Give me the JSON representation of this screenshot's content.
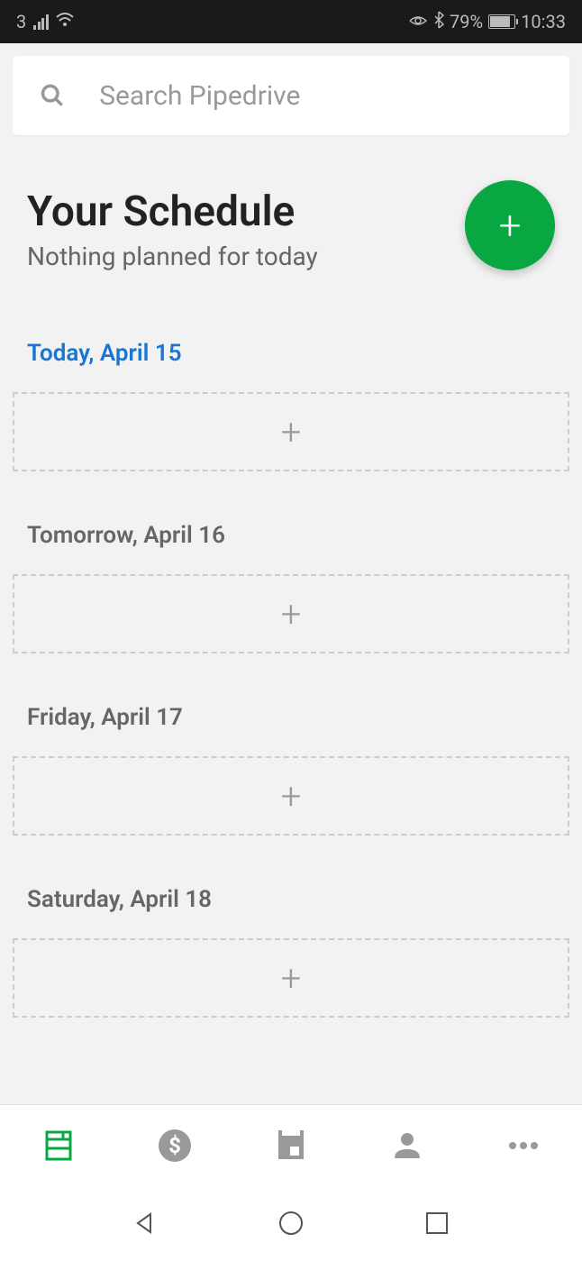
{
  "status_bar": {
    "network": "3",
    "battery_percent": "79%",
    "time": "10:33"
  },
  "search": {
    "placeholder": "Search Pipedrive"
  },
  "header": {
    "title": "Your Schedule",
    "subtitle": "Nothing planned for today"
  },
  "days": [
    {
      "label": "Today, April 15",
      "is_today": true
    },
    {
      "label": "Tomorrow, April 16",
      "is_today": false
    },
    {
      "label": "Friday, April 17",
      "is_today": false
    },
    {
      "label": "Saturday, April 18",
      "is_today": false
    }
  ],
  "tabs": [
    {
      "name": "schedule",
      "active": true
    },
    {
      "name": "deals",
      "active": false
    },
    {
      "name": "calendar",
      "active": false
    },
    {
      "name": "contacts",
      "active": false
    },
    {
      "name": "more",
      "active": false
    }
  ]
}
